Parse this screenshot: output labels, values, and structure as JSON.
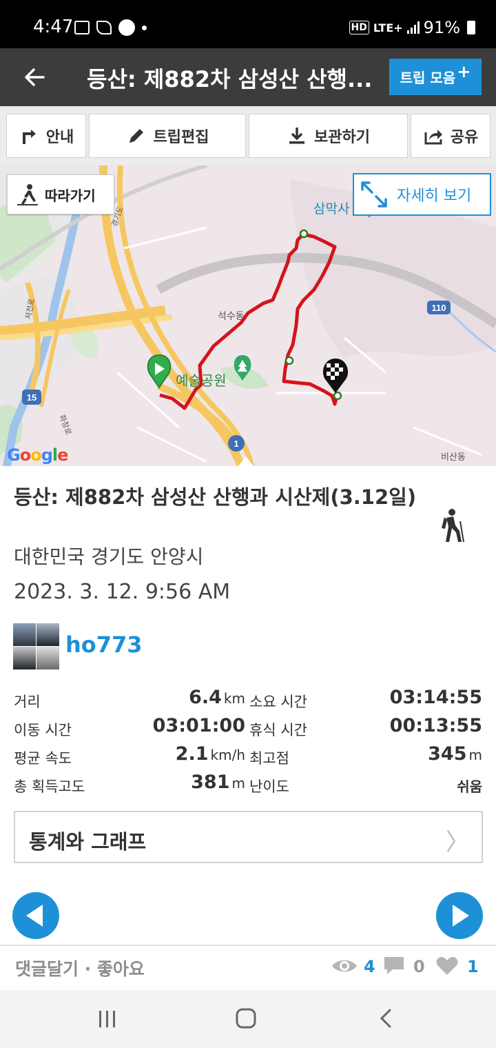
{
  "status_bar": {
    "time": "4:47",
    "network_badge": "HD",
    "network_type": "LTE+",
    "battery": "91%"
  },
  "app_bar": {
    "title": "등산: 제882차 삼성산 산행...",
    "trip_collection_label": "트립 모음",
    "trip_collection_plus": "+"
  },
  "toolbar": {
    "guide": "안내",
    "edit_trip": "트립편집",
    "save": "보관하기",
    "share": "공유"
  },
  "map": {
    "follow_label": "따라가기",
    "detail_label": "자세히 보기",
    "place_labels": {
      "temple": "삼막사",
      "dong_seoksu": "석수동",
      "park": "예술공원",
      "dong_bisan": "비산동",
      "road_gyeonggi": "경기도",
      "road_jeo": "저전로",
      "road_hwa": "화창로"
    },
    "road_numbers": {
      "r110": "110",
      "r15": "15",
      "r1": "1"
    },
    "attribution": {
      "g": "G",
      "o1": "o",
      "o2": "o",
      "g2": "g",
      "l": "l",
      "e": "e"
    },
    "route_color": "#d4141c",
    "accent_color": "#1e90d8"
  },
  "trip": {
    "title": "등산: 제882차 삼성산 산행과 시산제(3.12일)",
    "location": "대한민국 경기도 안양시",
    "datetime": "2023. 3. 12. 9:56 AM",
    "activity_icon": "hiking-icon",
    "user": "ho773"
  },
  "stats": {
    "distance_label": "거리",
    "distance_value": "6.4",
    "distance_unit": "km",
    "duration_label": "소요 시간",
    "duration_value": "03:14:55",
    "moving_label": "이동 시간",
    "moving_value": "03:01:00",
    "rest_label": "휴식 시간",
    "rest_value": "00:13:55",
    "speed_label": "평균 속도",
    "speed_value": "2.1",
    "speed_unit": "km/h",
    "peak_label": "최고점",
    "peak_value": "345",
    "peak_unit": "m",
    "gain_label": "총 획득고도",
    "gain_value": "381",
    "gain_unit": "m",
    "difficulty_label": "난이도",
    "difficulty_value": "쉬움"
  },
  "graph_button": {
    "label": "통계와 그래프",
    "chevron": "〉"
  },
  "social": {
    "comment_like": "댓글달기 · 좋아요",
    "views": "4",
    "comments": "0",
    "likes": "1"
  }
}
